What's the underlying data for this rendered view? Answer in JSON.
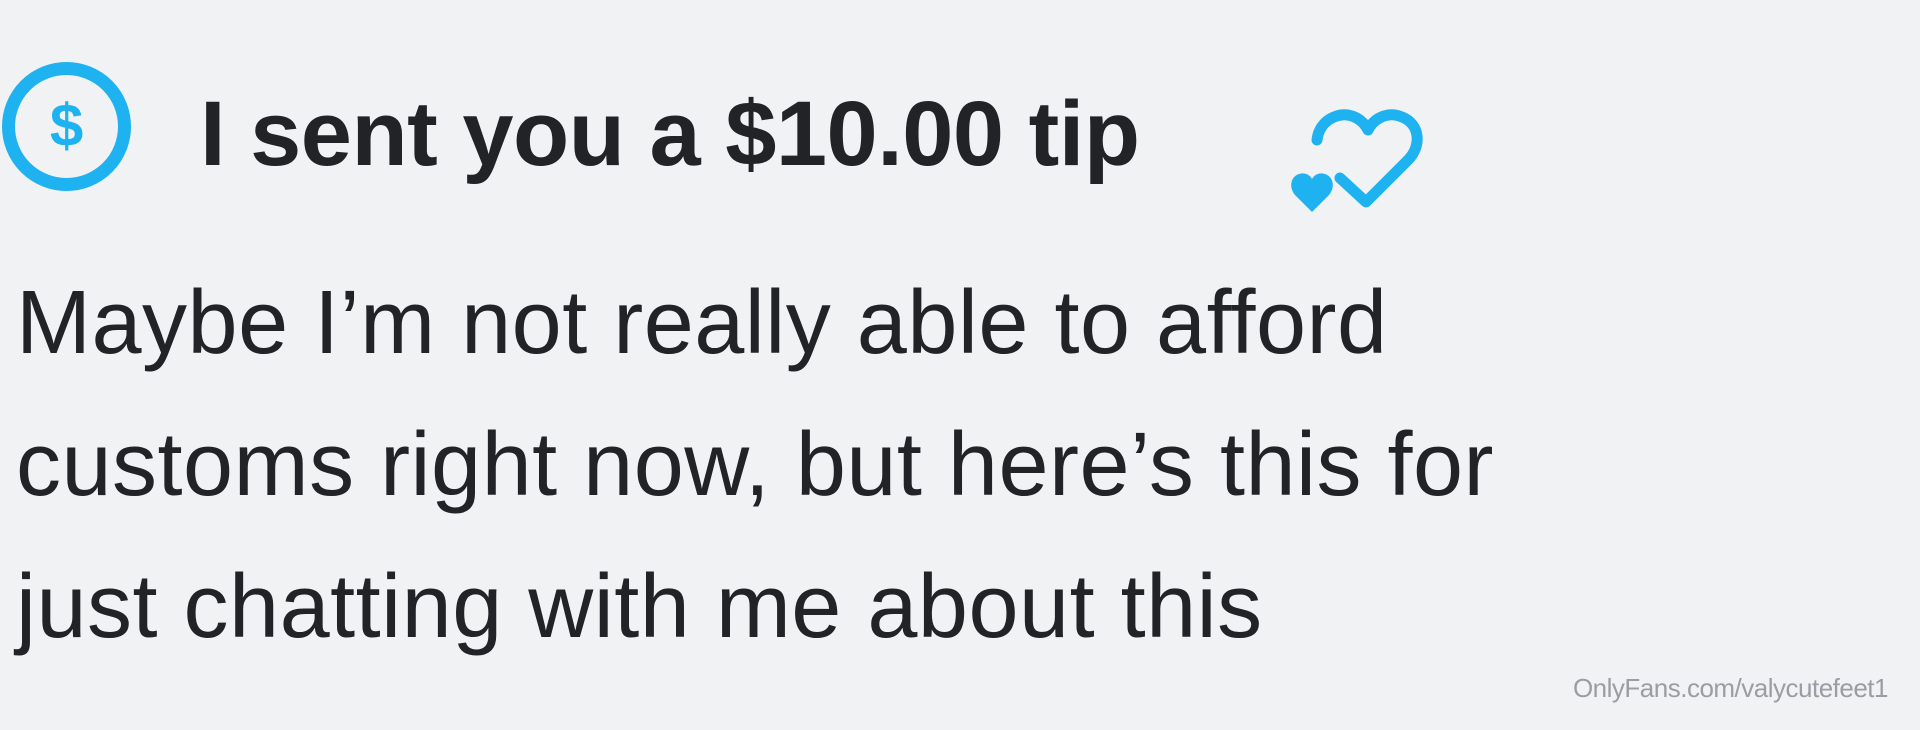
{
  "tip": {
    "icon": "dollar-circle-icon",
    "text": "I sent you a $10.00 tip",
    "reaction_icon": "heart-check-icon",
    "accent_color": "#1eb3f0"
  },
  "message": {
    "lines": [
      "Maybe I’m not really able to afford",
      "customs right now, but here’s this for",
      "just chatting with me about this"
    ]
  },
  "watermark": {
    "text": "OnlyFans.com/valycutefeet1"
  }
}
